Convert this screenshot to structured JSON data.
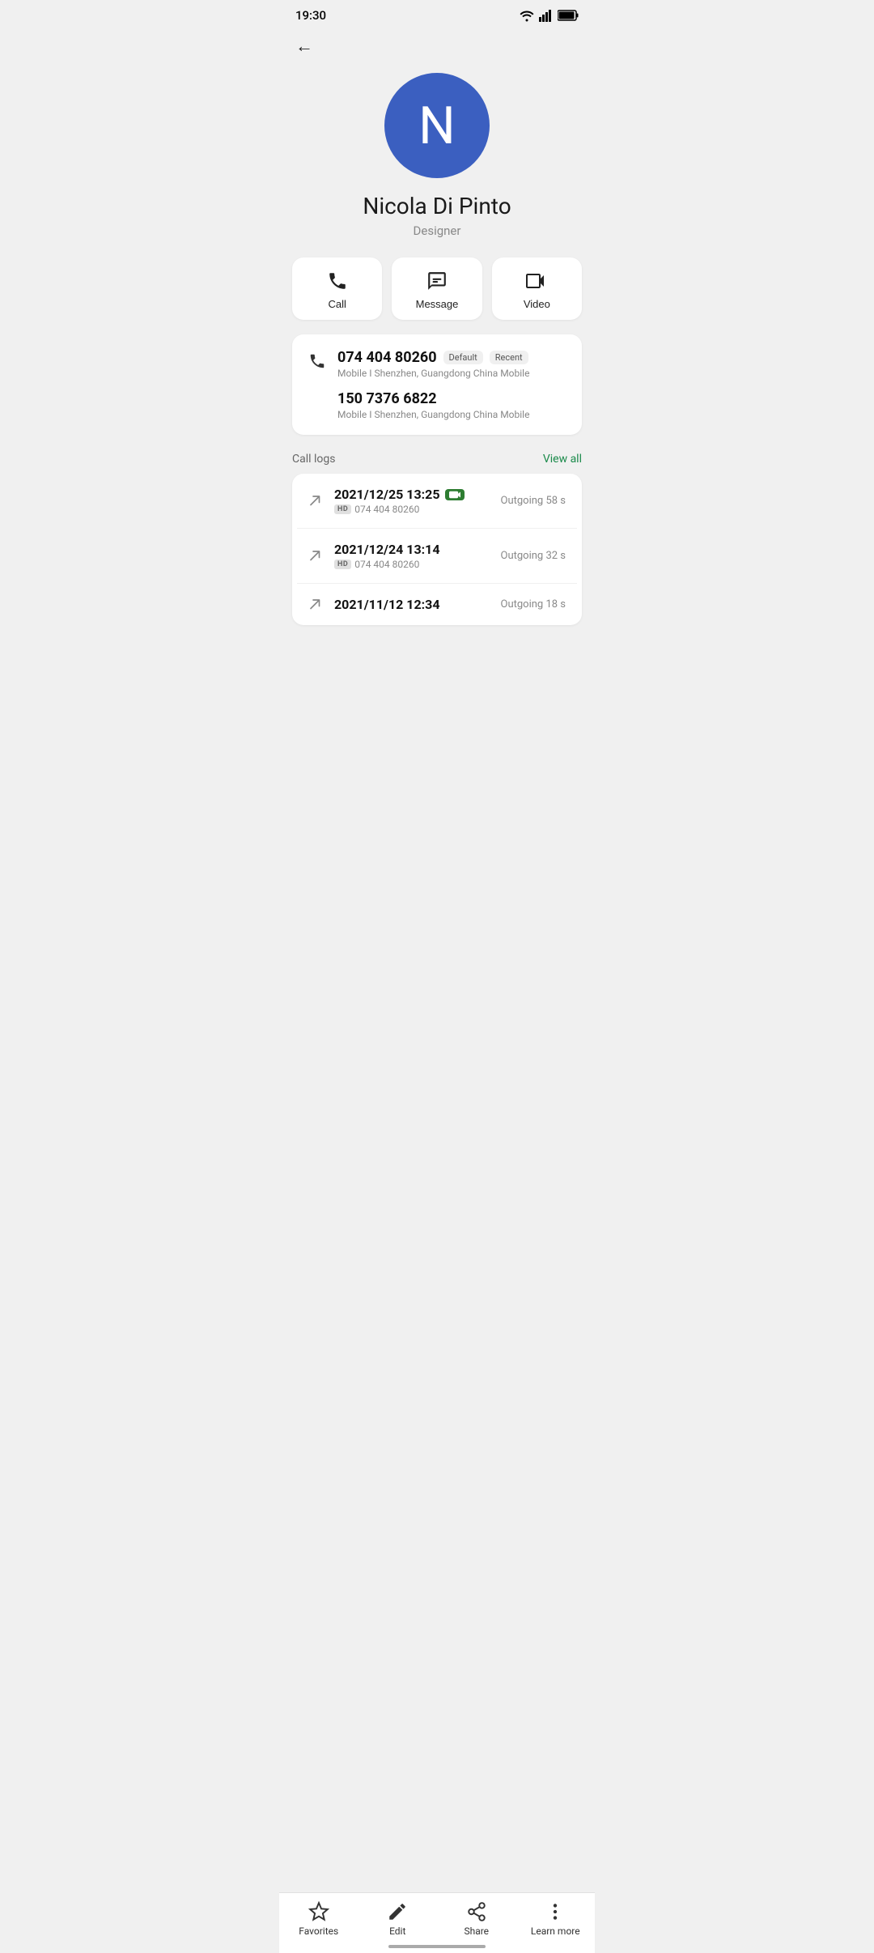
{
  "statusBar": {
    "time": "19:30"
  },
  "contact": {
    "initial": "N",
    "name": "Nicola Di Pinto",
    "title": "Designer",
    "avatarColor": "#3b5fc0"
  },
  "actions": [
    {
      "id": "call",
      "label": "Call"
    },
    {
      "id": "message",
      "label": "Message"
    },
    {
      "id": "video",
      "label": "Video"
    }
  ],
  "phoneNumbers": [
    {
      "number": "074 404 80260",
      "badges": [
        "Default",
        "Recent"
      ],
      "sub": "Mobile  I  Shenzhen, Guangdong China Mobile"
    },
    {
      "number": "150 7376 6822",
      "badges": [],
      "sub": "Mobile  I  Shenzhen, Guangdong China Mobile"
    }
  ],
  "callLogs": {
    "sectionLabel": "Call logs",
    "viewAllLabel": "View all",
    "items": [
      {
        "datetime": "2021/12/25 13:25",
        "hasVideoBadge": true,
        "number": "074 404 80260",
        "direction": "Outgoing",
        "duration": "58 s"
      },
      {
        "datetime": "2021/12/24 13:14",
        "hasVideoBadge": false,
        "number": "074 404 80260",
        "direction": "Outgoing",
        "duration": "32 s"
      },
      {
        "datetime": "2021/11/12 12:34",
        "hasVideoBadge": false,
        "number": "",
        "direction": "Outgoing",
        "duration": "18 s"
      }
    ]
  },
  "bottomNav": [
    {
      "id": "favorites",
      "label": "Favorites"
    },
    {
      "id": "edit",
      "label": "Edit"
    },
    {
      "id": "share",
      "label": "Share"
    },
    {
      "id": "learn-more",
      "label": "Learn more"
    }
  ]
}
